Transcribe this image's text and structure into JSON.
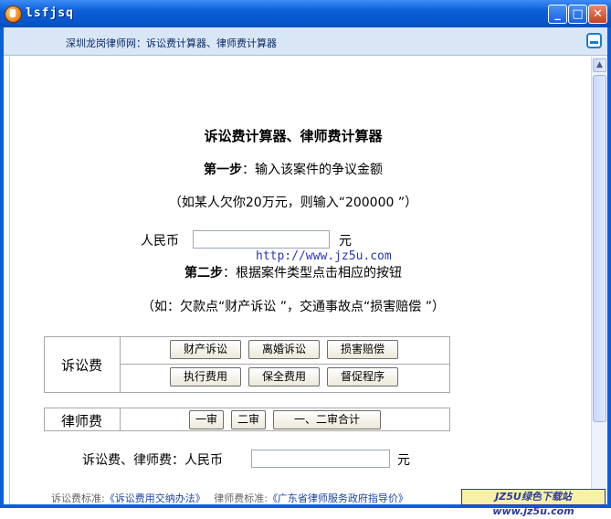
{
  "window": {
    "title": "lsfjsq"
  },
  "header": {
    "breadcrumb": "深圳龙岗律师网：诉讼费计算器、律师费计算器"
  },
  "main": {
    "title": "诉讼费计算器、律师费计算器",
    "step1_label": "第一步",
    "step1_text": "：输入该案件的争议金额",
    "step1_example": "（如某人欠你20万元，则输入“200000 ”）",
    "currency_label": "人民币",
    "amount_value": "",
    "unit": "元",
    "step2_label": "第二步",
    "step2_text": "：根据案件类型点击相应的按钮",
    "step2_example": "（如：欠款点“财产诉讼 ”，交通事故点“损害赔偿 ”）",
    "watermark": "http://www.jz5u.com"
  },
  "litigation": {
    "label": "诉讼费",
    "buttons_row1": [
      "财产诉讼",
      "离婚诉讼",
      "损害赔偿"
    ],
    "buttons_row2": [
      "执行费用",
      "保全费用",
      "督促程序"
    ]
  },
  "lawyer": {
    "label": "律师费",
    "buttons": [
      "一审",
      "二审",
      "一、二审合计"
    ]
  },
  "result": {
    "label": "诉讼费、律师费：人民币",
    "value": "",
    "unit": "元"
  },
  "footer": {
    "litigation_std_label": "诉讼费标准:",
    "litigation_std_link": "《诉讼费用交纳办法》",
    "lawyer_std_label": "律师费标准:",
    "lawyer_std_link": "《广东省律师服务政府指导价》",
    "badge": "JZ5U绿色下载站www.jz5u.com"
  },
  "colors": {
    "titlebar": "#0a5fd8",
    "header_bg": "#d9e6f5",
    "link": "#1a44a8"
  }
}
